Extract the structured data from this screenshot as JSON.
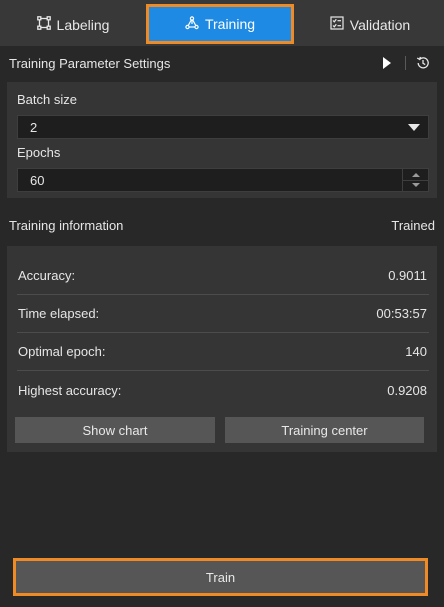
{
  "tabs": {
    "labeling": {
      "label": "Labeling",
      "icon": "labeling-icon"
    },
    "training": {
      "label": "Training",
      "icon": "training-icon"
    },
    "validation": {
      "label": "Validation",
      "icon": "validation-icon"
    }
  },
  "params": {
    "title": "Training Parameter Settings",
    "batch_label": "Batch size",
    "batch_value": "2",
    "epochs_label": "Epochs",
    "epochs_value": "60"
  },
  "info": {
    "title": "Training information",
    "status": "Trained",
    "rows": [
      {
        "label": "Accuracy:",
        "value": "0.9011"
      },
      {
        "label": "Time elapsed:",
        "value": "00:53:57"
      },
      {
        "label": "Optimal epoch:",
        "value": "140"
      },
      {
        "label": "Highest accuracy:",
        "value": "0.9208"
      }
    ],
    "show_chart": "Show chart",
    "training_center": "Training center"
  },
  "train_button": "Train",
  "colors": {
    "accent": "#1f8ae3",
    "highlight": "#f08a24",
    "background": "#282828",
    "panel": "#353535"
  }
}
